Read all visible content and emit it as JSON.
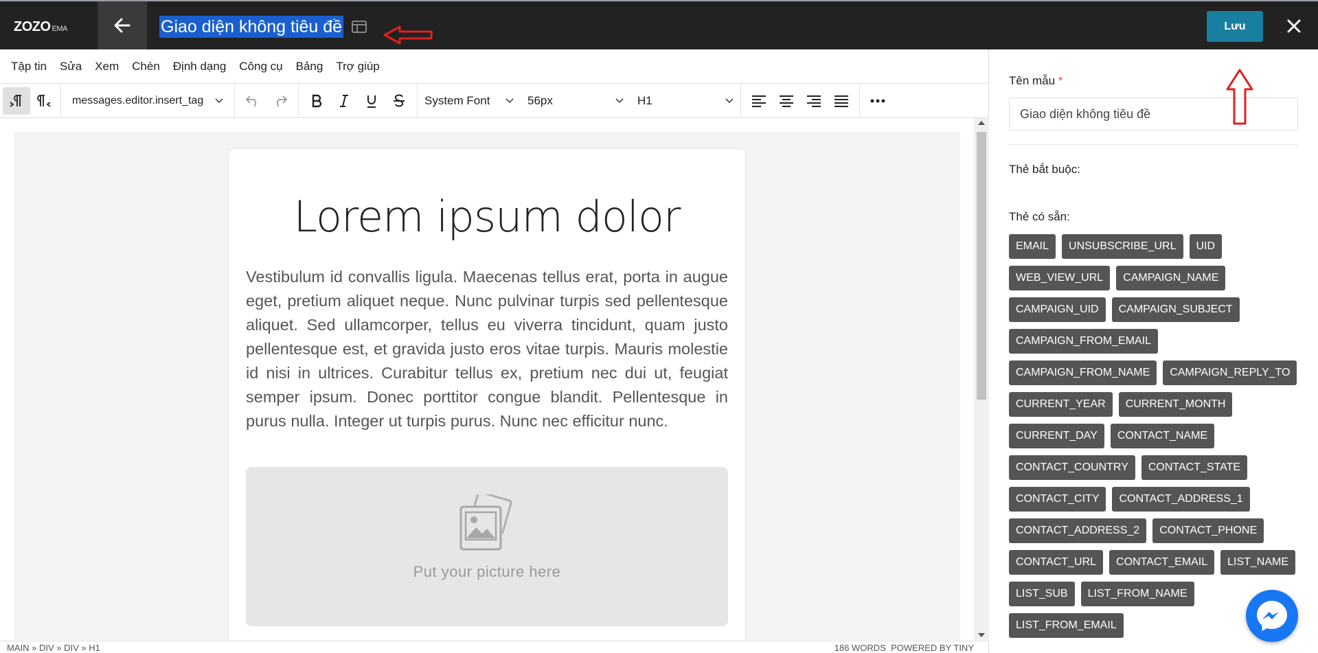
{
  "brand": {
    "logo": "ZOZO",
    "logo_suffix": "EMA"
  },
  "header": {
    "title": "Giao diện không tiêu đề",
    "save_label": "Lưu"
  },
  "menu": [
    "Tập tin",
    "Sửa",
    "Xem",
    "Chèn",
    "Định dạng",
    "Công cụ",
    "Bảng",
    "Trợ giúp"
  ],
  "toolbar": {
    "insert_tag": "messages.editor.insert_tag",
    "font_family": "System Font",
    "font_size": "56px",
    "block_format": "H1"
  },
  "content": {
    "heading": "Lorem ipsum dolor",
    "paragraph": "Vestibulum id convallis ligula. Maecenas tellus erat, porta in augue eget, pretium aliquet neque. Nunc pulvinar turpis sed pellentesque aliquet. Sed ullamcorper, tellus eu viverra tincidunt, quam justo pellentesque est, et gravida justo eros vitae turpis. Mauris molestie id nisi in ultrices. Curabitur tellus ex, pretium nec dui ut, feugiat semper ipsum. Donec porttitor congue blandit. Pellentesque in purus nulla. Integer ut turpis purus. Nunc nec efficitur nunc.",
    "picture_placeholder": "Put your picture here"
  },
  "status": {
    "path": "MAIN » DIV » DIV » H1",
    "words": "186 WORDS",
    "powered": "POWERED BY TINY"
  },
  "sidebar": {
    "name_label": "Tên mẫu",
    "required_mark": "*",
    "name_value": "Giao diện không tiêu đề",
    "required_tags_label": "Thẻ bắt buộc:",
    "available_tags_label": "Thẻ có sẵn:",
    "tags": [
      "EMAIL",
      "UNSUBSCRIBE_URL",
      "UID",
      "WEB_VIEW_URL",
      "CAMPAIGN_NAME",
      "CAMPAIGN_UID",
      "CAMPAIGN_SUBJECT",
      "CAMPAIGN_FROM_EMAIL",
      "CAMPAIGN_FROM_NAME",
      "CAMPAIGN_REPLY_TO",
      "CURRENT_YEAR",
      "CURRENT_MONTH",
      "CURRENT_DAY",
      "CONTACT_NAME",
      "CONTACT_COUNTRY",
      "CONTACT_STATE",
      "CONTACT_CITY",
      "CONTACT_ADDRESS_1",
      "CONTACT_ADDRESS_2",
      "CONTACT_PHONE",
      "CONTACT_URL",
      "CONTACT_EMAIL",
      "LIST_NAME",
      "LIST_SUB",
      "LIST_FROM_NAME",
      "LIST_FROM_EMAIL"
    ]
  },
  "colors": {
    "topbar": "#222222",
    "save": "#197fa0",
    "tag": "#555555",
    "annotation": "#e02020",
    "messenger": "#1877f2"
  }
}
